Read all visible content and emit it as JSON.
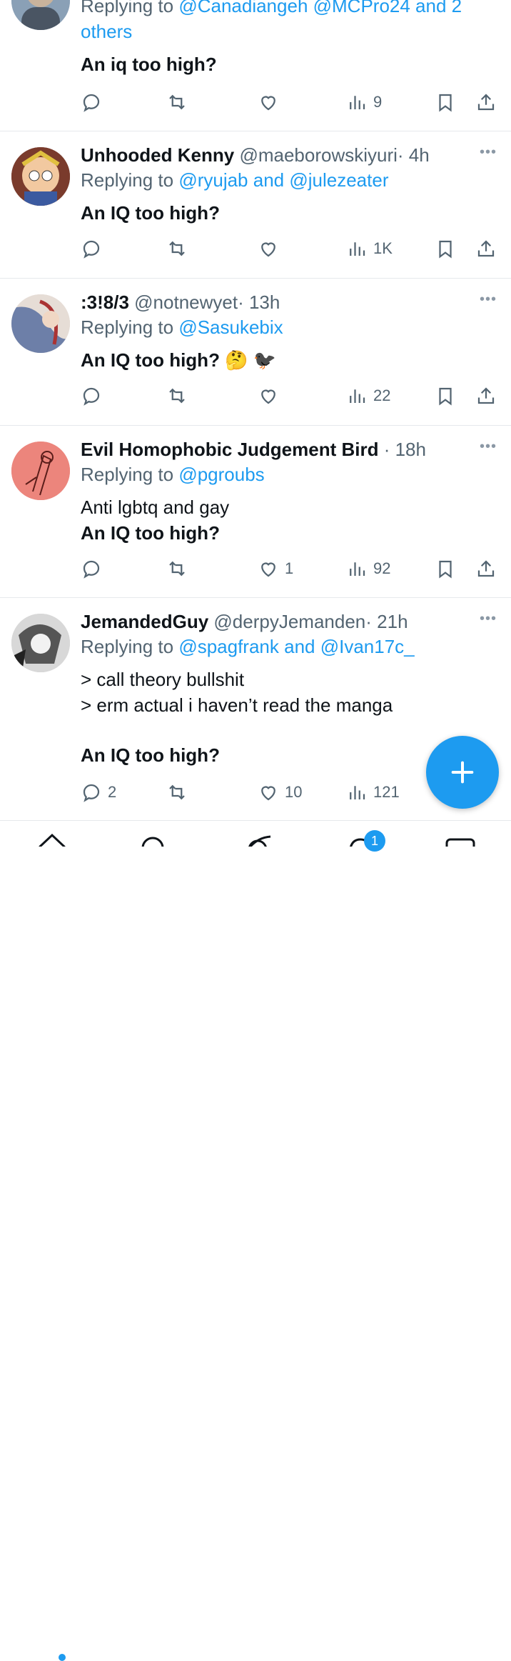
{
  "colors": {
    "accent": "#1d9bf0",
    "secondary_text": "#536471",
    "primary_text": "#0f1419",
    "divider": "#e6e9ec"
  },
  "tweets": [
    {
      "reply_prefix": "Replying to",
      "reply_targets": "@Canadiangeh @MCPro24 and 2 others",
      "lines": [
        "An iq too high?"
      ],
      "views": "9"
    },
    {
      "name": "Unhooded Kenny",
      "handle": "@maeborowskiyuri",
      "time": "· 4h",
      "reply_prefix": "Replying to",
      "reply_targets": "@ryujab and @julezeater",
      "lines": [
        "An IQ too high?"
      ],
      "views": "1K"
    },
    {
      "name": ":3!8/3",
      "handle": "@notnewyet",
      "time": "· 13h",
      "reply_prefix": "Replying to",
      "reply_targets": "@Sasukebix",
      "lines": [
        "An IQ too high? 🤔 🐦‍⬛"
      ],
      "views": "22"
    },
    {
      "name": "Evil Homophobic Judgement Bird",
      "time": "· 18h",
      "reply_prefix": "Replying to",
      "reply_targets": "@pgroubs",
      "lines": [
        "Anti lgbtq and gay",
        "An IQ too high?"
      ],
      "likes": "1",
      "views": "92"
    },
    {
      "name": "JemandedGuy",
      "handle": "@derpyJemanden",
      "time": "· 21h",
      "reply_prefix": "Replying to",
      "reply_targets": "@spagfrank and @Ivan17c_",
      "lines": [
        "> call theory bullshit",
        "> erm actual i haven’t read the manga",
        "An IQ too high?"
      ],
      "replies": "2",
      "likes": "10",
      "views": "121"
    }
  ],
  "more_label": "•••",
  "icons": [
    "reply-icon",
    "retweet-icon",
    "like-icon",
    "views-icon",
    "bookmark-icon",
    "share-icon",
    "compose-plus-icon"
  ],
  "tabbar": {
    "notification_count": "1"
  }
}
